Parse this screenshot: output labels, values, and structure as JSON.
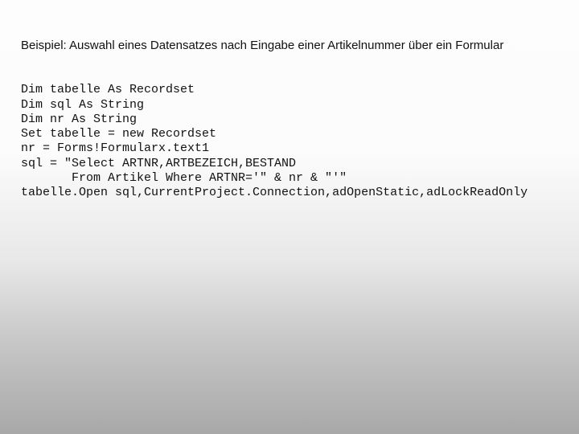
{
  "heading": "Beispiel: Auswahl eines Datensatzes nach Eingabe einer Artikelnummer über ein Formular",
  "code": {
    "l1": "Dim tabelle As Recordset",
    "l2": "Dim sql As String",
    "l3": "Dim nr As String",
    "l4": "Set tabelle = new Recordset",
    "l5": "nr = Forms!Formularx.text1",
    "l6": "sql = \"Select ARTNR,ARTBEZEICH,BESTAND",
    "l7": "       From Artikel Where ARTNR='\" & nr & \"'\"",
    "l8": "tabelle.Open sql,CurrentProject.Connection,adOpenStatic,adLockReadOnly"
  }
}
